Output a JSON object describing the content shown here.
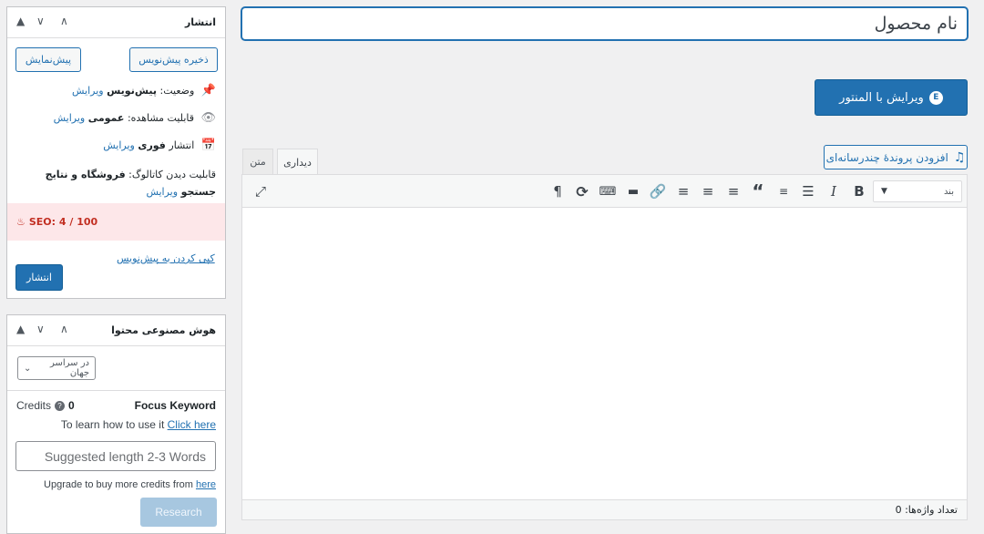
{
  "title_field": {
    "placeholder": "نام محصول"
  },
  "editor": {
    "elementor_label": "ویرایش با المنتور",
    "add_media_label": "افزودن پروندهٔ چندرسانه‌ای",
    "tabs": {
      "visual": "دیداری",
      "text": "متن"
    },
    "format_select": "بند",
    "word_count": "تعداد واژه‌ها: 0"
  },
  "publish_box": {
    "title": "انتشار",
    "save_draft_label": "ذخیره پیش‌نویس",
    "preview_label": "پیش‌نمایش",
    "status_label": "وضعیت:",
    "status_value": "پیش‌نویس",
    "edit_label": "ویرایش",
    "visibility_label": "قابلیت مشاهده:",
    "visibility_value": "عمومی",
    "publish_time_label": "انتشار",
    "publish_time_value": "فوری",
    "catalog_label": "قابلیت دیدن کاتالوگ:",
    "catalog_value_1": "فروشگاه و نتایج",
    "catalog_value_2": "جستجو",
    "seo_text": "SEO: 4 / 100",
    "trash_label": "کپی کردن به پیش‌نویس",
    "publish_label": "انتشار"
  },
  "ai_box": {
    "title": "هوش مصنوعی محتوا",
    "language_select": "در سراسر جهان",
    "credits_label": "Credits",
    "credits_value": "0",
    "focus_keyword_label": "Focus Keyword",
    "learn_text": "To learn how to use it",
    "learn_link": "Click here",
    "keyword_placeholder": "Suggested length 2-3 Words",
    "upgrade_text": "Upgrade to buy more credits from",
    "upgrade_link": "here",
    "research_label": "Research"
  },
  "colors": {
    "accent": "#2271b1",
    "seo_bg": "#fde7e9",
    "seo_text": "#c22f22"
  }
}
